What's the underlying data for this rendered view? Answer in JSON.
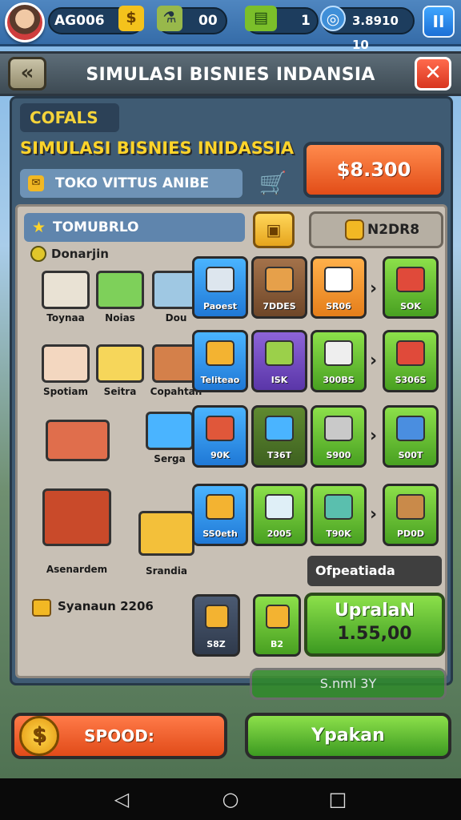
{
  "hud": {
    "player_name": "AG006",
    "stat_a_value": "00",
    "stat_b_value": "1",
    "coins_value": "3.8910 10",
    "pause_label": "II"
  },
  "titlebar": {
    "title": "SIMULASI BISNIES INDANSIA",
    "back_label": "«",
    "close_label": "✕"
  },
  "panel": {
    "tag": "COFALS",
    "subtitle": "SIMULASI BISNIES INIDASSIA",
    "store_name": "TOKO VITTUS ANIBE",
    "price_button": "$8.300"
  },
  "inner": {
    "category": "TOMUBRLO",
    "info_label": "N2DR8",
    "description": "Donarjin",
    "left_items": [
      {
        "label": "Toynaa"
      },
      {
        "label": "Noias"
      },
      {
        "label": "Dou"
      },
      {
        "label": "Spotiam"
      },
      {
        "label": "Seitra"
      },
      {
        "label": "Copahtan"
      },
      {
        "label": "Serga"
      },
      {
        "label": "Asenardem"
      },
      {
        "label": "Srandia"
      }
    ],
    "grid": [
      {
        "label": "Paoest"
      },
      {
        "label": "7DDES"
      },
      {
        "label": "SR06"
      },
      {
        "label": "SOK"
      },
      {
        "label": "Teliteao"
      },
      {
        "label": "ISK"
      },
      {
        "label": "300BS"
      },
      {
        "label": "S306S"
      },
      {
        "label": "90K"
      },
      {
        "label": "T36T"
      },
      {
        "label": "S900"
      },
      {
        "label": "S00T"
      },
      {
        "label": "SS0eth"
      },
      {
        "label": "2005"
      },
      {
        "label": "T90K"
      },
      {
        "label": "PD0D"
      }
    ],
    "operate_label": "Ofpeatiada",
    "stock_label": "Syanaun 2206",
    "bottom_tiles": [
      {
        "label": "S8Z"
      },
      {
        "label": "B2"
      }
    ],
    "upgrade_title": "UpralaN",
    "upgrade_price": "1.55,00",
    "disabled_label": "S.nml 3Y"
  },
  "buttons": {
    "spood": "SPOOD:",
    "ypakan": "Ypakan"
  },
  "colors": {
    "accent_orange": "#e24d18",
    "accent_green": "#48a021",
    "title_yellow": "#ffd42a",
    "panel_blue": "#3f5b73"
  }
}
